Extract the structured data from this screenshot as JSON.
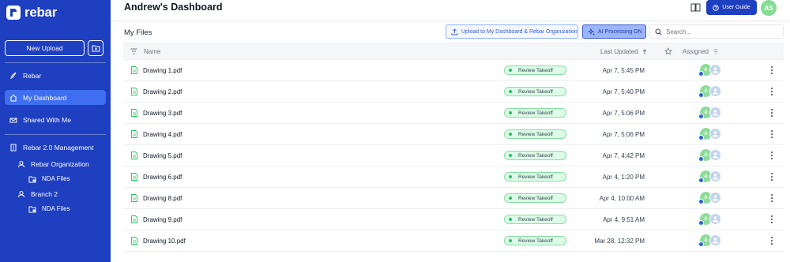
{
  "brand": {
    "name": "rebar",
    "color": "#1e3fbf"
  },
  "sidebar": {
    "upload_label": "New Upload",
    "items": [
      {
        "label": "Rebar",
        "icon": "rocket-icon"
      },
      {
        "label": "My Dashboard",
        "icon": "home-icon",
        "active": true
      },
      {
        "label": "Shared With Me",
        "icon": "inbox-icon"
      }
    ],
    "management": {
      "label": "Rebar 2.0 Management",
      "children": [
        {
          "label": "Rebar Organization",
          "child": "NDA Files"
        },
        {
          "label": "Branch 2",
          "child": "NDA Files"
        }
      ]
    }
  },
  "header": {
    "title": "Andrew's Dashboard",
    "guide_label": "User Guide",
    "user_initials": "AS"
  },
  "toolbar": {
    "section_title": "My Files",
    "upload_button": "Upload to My Dashboard & Rebar Organization",
    "ai_button": "AI Processing ON",
    "search_placeholder": "Search..."
  },
  "table": {
    "columns": {
      "name": "Name",
      "updated": "Last Updated",
      "assigned": "Assigned"
    },
    "rows": [
      {
        "name": "Drawing 1.pdf",
        "status": "Review Takeoff",
        "date": "Apr 7, 5:45 PM",
        "avatar": "A"
      },
      {
        "name": "Drawing 2.pdf",
        "status": "Review Takeoff",
        "date": "Apr 7, 5:40 PM",
        "avatar": "A"
      },
      {
        "name": "Drawing 3.pdf",
        "status": "Review Takeoff",
        "date": "Apr 7, 5:06 PM",
        "avatar": "A"
      },
      {
        "name": "Drawing 4.pdf",
        "status": "Review Takeoff",
        "date": "Apr 7, 5:06 PM",
        "avatar": "A"
      },
      {
        "name": "Drawing 5.pdf",
        "status": "Review Takeoff",
        "date": "Apr 7, 4:42 PM",
        "avatar": "A"
      },
      {
        "name": "Drawing 6.pdf",
        "status": "Review Takeoff",
        "date": "Apr 4, 1:20 PM",
        "avatar": "A"
      },
      {
        "name": "Drawing 8.pdf",
        "status": "Review Takeoff",
        "date": "Apr 4, 10:00 AM",
        "avatar": "A"
      },
      {
        "name": "Drawing 9.pdf",
        "status": "Review Takeoff",
        "date": "Apr 4, 9:51 AM",
        "avatar": "A"
      },
      {
        "name": "Drawing 10.pdf",
        "status": "Review Takeoff",
        "date": "Mar 28, 12:32 PM",
        "avatar": "A"
      }
    ]
  }
}
